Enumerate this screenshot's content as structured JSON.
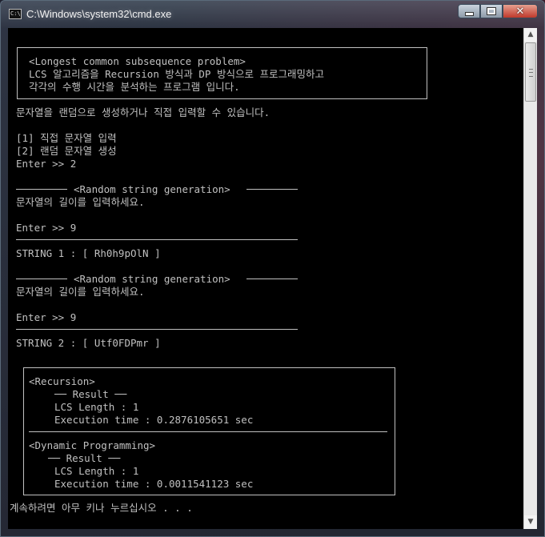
{
  "window": {
    "title": "C:\\Windows\\system32\\cmd.exe",
    "icon": "cmd-icon",
    "controls": [
      "minimize-icon",
      "maximize-icon",
      "close-icon"
    ]
  },
  "console": {
    "intro": {
      "line1": "<Longest common subsequence problem>",
      "line2": "LCS 알고리즘을 Recursion 방식과 DP 방식으로 프로그래밍하고",
      "line3": "각각의 수행 시간을 분석하는 프로그램 입니다."
    },
    "prompt_line": "문자열을 랜덤으로 생성하거나 직접 입력할 수 있습니다.",
    "menu": {
      "option1": "[1] 직접 문자열 입력",
      "option2": "[2] 랜덤 문자열 생성",
      "enter": "Enter >> 2"
    },
    "gen1": {
      "header": "<Random string generation>",
      "ask": "문자열의 길이를 입력하세요.",
      "enter": "Enter >> 9",
      "result": "STRING 1 : [ Rh0h9pOlN ]"
    },
    "gen2": {
      "header": "<Random string generation>",
      "ask": "문자열의 길이를 입력하세요.",
      "enter": "Enter >> 9",
      "result": "STRING 2 : [ Utf0FDPmr ]"
    },
    "results": {
      "recursion": {
        "title": "<Recursion>",
        "sub": "── Result ──",
        "lcs": "LCS Length : 1",
        "time": "Execution time : 0.2876105651 sec"
      },
      "dp": {
        "title": "<Dynamic Programming>",
        "sub": "── Result ──",
        "lcs": "LCS Length : 1",
        "time": "Execution time : 0.0011541123 sec"
      }
    },
    "pause": "계속하려면 아무 키나 누르십시오 . . ."
  }
}
